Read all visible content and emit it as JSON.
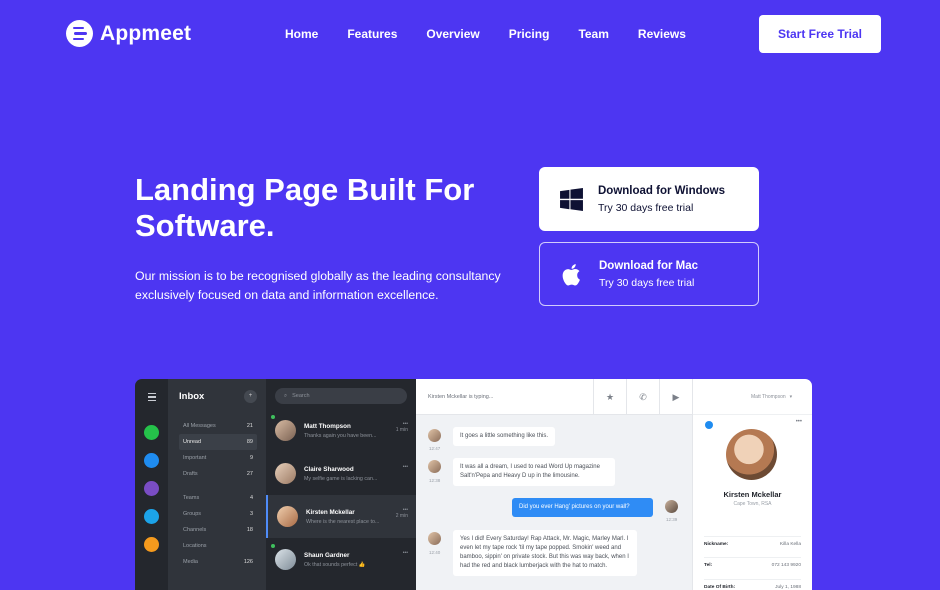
{
  "brand": {
    "name": "Appmeet"
  },
  "nav": {
    "items": [
      "Home",
      "Features",
      "Overview",
      "Pricing",
      "Team",
      "Reviews"
    ],
    "cta": "Start Free Trial"
  },
  "hero": {
    "title": "Landing Page Built For Software.",
    "description": "Our mission is to be recognised globally as the leading consultancy exclusively focused on data and information excellence."
  },
  "downloads": {
    "windows": {
      "title": "Download for Windows",
      "subtitle": "Try 30 days free trial",
      "icon": "windows-icon"
    },
    "mac": {
      "title": "Download for Mac",
      "subtitle": "Try 30 days free trial",
      "icon": "apple-icon"
    }
  },
  "colors": {
    "background": "#4d36f2",
    "cta_text": "#4d36f2",
    "app_dark": "#24272d",
    "app_panel": "#30343b",
    "message_blue": "#2f8cf5"
  },
  "app": {
    "inbox": {
      "title": "Inbox",
      "folders": [
        {
          "label": "All Messages",
          "count": "21"
        },
        {
          "label": "Unread",
          "count": "89"
        },
        {
          "label": "Important",
          "count": "9"
        },
        {
          "label": "Drafts",
          "count": "27"
        }
      ],
      "sections": [
        {
          "label": "Teams",
          "count": "4"
        },
        {
          "label": "Groups",
          "count": "3"
        },
        {
          "label": "Channels",
          "count": "18"
        },
        {
          "label": "Locations",
          "count": ""
        },
        {
          "label": "Media",
          "count": "126"
        }
      ]
    },
    "search_placeholder": "Search",
    "chats": [
      {
        "name": "Matt Thompson",
        "preview": "Thanks again you have been...",
        "time": "1 min"
      },
      {
        "name": "Claire Sharwood",
        "preview": "My selfie game is lacking can...",
        "time": ""
      },
      {
        "name": "Kirsten Mckellar",
        "preview": "Where is the nearest place to...",
        "time": "2 min"
      },
      {
        "name": "Shaun Gardner",
        "preview": "Ok that sounds perfect 👍",
        "time": ""
      }
    ],
    "conversation": {
      "typing": "Kirsten Mckellar is typing...",
      "messages": [
        {
          "text": "It goes a little something like this.",
          "time": "12:47",
          "dir": "in"
        },
        {
          "text": "It was all a dream, I used to read Word Up magazine Salt'n'Pepa and Heavy D up in the limousine.",
          "time": "12:38",
          "dir": "in"
        },
        {
          "text": "Did you ever Hang' pictures on your wall?",
          "time": "12:39",
          "dir": "out"
        },
        {
          "text": "Yes I did! Every Saturday! Rap Attack, Mr. Magic, Marley Marl. I even let my tape rock 'til my tape popped. Smokin' weed and bamboo, sippin' on private stock. But this was way back, when I had the red and black lumberjack with the hat to match.",
          "time": "12:40",
          "dir": "in"
        }
      ]
    },
    "profile": {
      "header": "Matt Thompson",
      "name": "Kirsten Mckellar",
      "location": "Cape Town, RSA",
      "fields": [
        {
          "label": "Nickname:",
          "value": "Killa Kella"
        },
        {
          "label": "Tel:",
          "value": "072 143 9920"
        },
        {
          "label": "Date Of Birth:",
          "value": "July 1, 1988"
        }
      ]
    }
  }
}
